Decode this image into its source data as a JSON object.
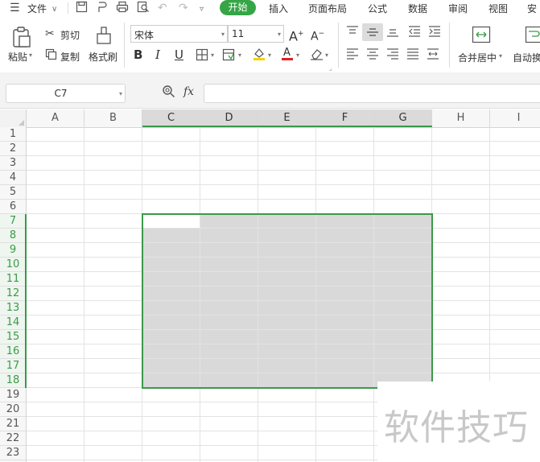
{
  "menubar": {
    "file_label": "文件",
    "tabs": [
      {
        "label": "开始",
        "active": true
      },
      {
        "label": "插入",
        "active": false
      },
      {
        "label": "页面布局",
        "active": false
      },
      {
        "label": "公式",
        "active": false
      },
      {
        "label": "数据",
        "active": false
      },
      {
        "label": "审阅",
        "active": false
      },
      {
        "label": "视图",
        "active": false
      },
      {
        "label": "安",
        "active": false
      }
    ]
  },
  "ribbon": {
    "paste_label": "粘贴",
    "cut_label": "剪切",
    "copy_label": "复制",
    "format_painter_label": "格式刷",
    "font_name": "宋体",
    "font_size": "11",
    "merge_center_label": "合并居中",
    "autowrap_label": "自动换"
  },
  "formula_bar": {
    "name_box": "C7",
    "fx": "fx",
    "formula": ""
  },
  "sheet": {
    "columns": [
      "A",
      "B",
      "C",
      "D",
      "E",
      "F",
      "G",
      "H",
      "I"
    ],
    "selected_columns": [
      "C",
      "D",
      "E",
      "F",
      "G"
    ],
    "rows": [
      "1",
      "2",
      "3",
      "4",
      "5",
      "6",
      "7",
      "8",
      "9",
      "10",
      "11",
      "12",
      "13",
      "14",
      "15",
      "16",
      "17",
      "18",
      "19",
      "20",
      "21",
      "22",
      "23"
    ],
    "selected_rows": [
      "7",
      "8",
      "9",
      "10",
      "11",
      "12",
      "13",
      "14",
      "15",
      "16",
      "17",
      "18"
    ],
    "selection": "C7:G18",
    "active_cell": "C7"
  },
  "watermark": "软件技巧",
  "colors": {
    "accent": "#35a546",
    "selection_border": "#3a9a48",
    "selection_fill": "#d9d9d9"
  }
}
